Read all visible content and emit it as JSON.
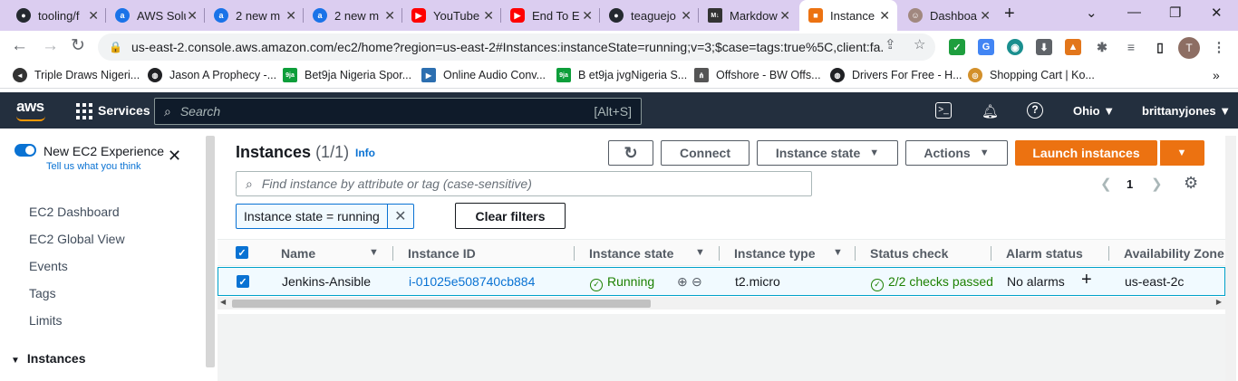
{
  "browser": {
    "tabs": [
      {
        "title": "tooling/f",
        "icon": "github-icon",
        "color": "#24292f",
        "active": false
      },
      {
        "title": "AWS Solu",
        "icon": "aws-favicon-icon",
        "color": "#1a73e8",
        "active": false
      },
      {
        "title": "2 new m",
        "icon": "aws-favicon-icon",
        "color": "#1a73e8",
        "active": false
      },
      {
        "title": "2 new m",
        "icon": "aws-favicon-icon",
        "color": "#1a73e8",
        "active": false
      },
      {
        "title": "YouTube",
        "icon": "youtube-icon",
        "color": "#ff0000",
        "active": false
      },
      {
        "title": "End To E",
        "icon": "youtube-icon",
        "color": "#ff0000",
        "active": false
      },
      {
        "title": "teaguejo",
        "icon": "github-icon",
        "color": "#24292f",
        "active": false
      },
      {
        "title": "Markdow",
        "icon": "markdown-icon",
        "color": "#333333",
        "active": false
      },
      {
        "title": "Instance",
        "icon": "ec2-icon",
        "color": "#ec7211",
        "active": true
      },
      {
        "title": "Dashboa",
        "icon": "avatar-icon",
        "color": "#a1887f",
        "active": false
      }
    ],
    "url": "us-east-2.console.aws.amazon.com/ec2/home?region=us-east-2#Instances:instanceState=running;v=3;$case=tags:true%5C,client:fa...",
    "profile_initial": "T",
    "bookmarks": [
      {
        "label": "Triple Draws Nigeri...",
        "icon": "rewind-icon",
        "color": "#333333"
      },
      {
        "label": "Jason A Prophecy -...",
        "icon": "globe-icon",
        "color": "#202124"
      },
      {
        "label": "Bet9ja Nigeria Spor...",
        "icon": "bet9ja-icon",
        "color": "#0d9e3a"
      },
      {
        "label": "Online Audio Conv...",
        "icon": "audio-icon",
        "color": "#2c6fb0"
      },
      {
        "label": "B et9ja jvgNigeria S...",
        "icon": "bet9ja-icon",
        "color": "#0d9e3a"
      },
      {
        "label": "Offshore - BW Offs...",
        "icon": "offshore-icon",
        "color": "#555555"
      },
      {
        "label": "Drivers For Free - H...",
        "icon": "globe-icon",
        "color": "#202124"
      },
      {
        "label": "Shopping Cart | Ko...",
        "icon": "cart-icon",
        "color": "#d3902b"
      }
    ]
  },
  "aws_header": {
    "logo": "aws",
    "services": "Services",
    "search_placeholder": "Search",
    "search_shortcut": "[Alt+S]",
    "region": "Ohio",
    "user": "brittanyjones"
  },
  "sidebar": {
    "new_experience": "New EC2 Experience",
    "tell_us": "Tell us what you think",
    "items": [
      "EC2 Dashboard",
      "EC2 Global View",
      "Events",
      "Tags",
      "Limits"
    ],
    "section": "Instances"
  },
  "main": {
    "title": "Instances",
    "count": "(1/1)",
    "info": "Info",
    "buttons": {
      "connect": "Connect",
      "instance_state": "Instance state",
      "actions": "Actions",
      "launch": "Launch instances"
    },
    "filter_placeholder": "Find instance by attribute or tag (case-sensitive)",
    "page": "1",
    "token": "Instance state = running",
    "clear_filters": "Clear filters",
    "columns": [
      "Name",
      "Instance ID",
      "Instance state",
      "Instance type",
      "Status check",
      "Alarm status",
      "Availability Zone"
    ],
    "row": {
      "name": "Jenkins-Ansible",
      "instance_id": "i-01025e508740cb884",
      "state": "Running",
      "type": "t2.micro",
      "status_check": "2/2 checks passed",
      "alarm": "No alarms",
      "az": "us-east-2c"
    }
  }
}
